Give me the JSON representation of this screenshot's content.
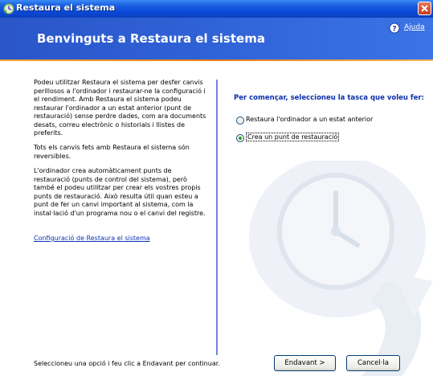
{
  "window": {
    "title": "Restaura el sistema"
  },
  "banner": {
    "heading": "Benvinguts a Restaura el sistema",
    "help_label": "Ajuda"
  },
  "intro": {
    "paragraph1": "Podeu utilitzar Restaura el sistema per desfer canvis perillosos a l'ordinador i restaurar-ne la configuració i el rendiment. Amb Restaura el sistema podeu restaurar l'ordinador a un estat anterior (punt de restauració) sense perdre dades, com ara documents desats, correu electrònic o historials i llistes de preferits.",
    "paragraph2": "Tots els canvis fets amb Restaura el sistema són reversibles.",
    "paragraph3": "L'ordinador crea automàticament punts de restauració (punts de control del sistema), però també el podeu utilitzar per crear els vostres propis punts de restauració. Això resulta útil quan esteu a punt de fer un canvi important al sistema, com la instal·lació d'un programa nou o el canvi del registre.",
    "config_link": "Configuració de Restaura el sistema"
  },
  "task": {
    "heading": "Per començar, seleccioneu la tasca que voleu fer:",
    "options": [
      {
        "label": "Restaura l'ordinador a un estat anterior",
        "selected": false
      },
      {
        "label": "Crea un punt de restauració",
        "selected": true
      }
    ]
  },
  "footer": {
    "instruction": "Seleccioneu una opció i feu clic a Endavant per continuar.",
    "next_label": "Endavant >",
    "cancel_label": "Cancel·la"
  },
  "colors": {
    "banner_blue": "#2f61d6",
    "accent_orange": "#e97e1c",
    "heading_blue": "#0b2fa8",
    "link_blue": "#0a34b8"
  },
  "icons": {
    "app": "system-restore-icon",
    "help": "help-icon",
    "close": "close-icon",
    "watermark": "clock-restore-watermark"
  }
}
